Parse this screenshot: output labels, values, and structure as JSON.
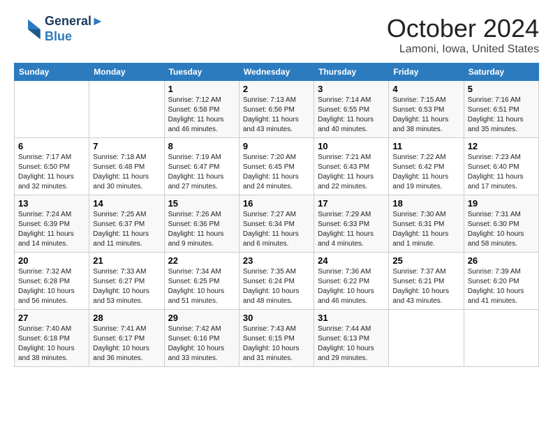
{
  "logo": {
    "line1": "General",
    "line2": "Blue"
  },
  "title": "October 2024",
  "location": "Lamoni, Iowa, United States",
  "days_of_week": [
    "Sunday",
    "Monday",
    "Tuesday",
    "Wednesday",
    "Thursday",
    "Friday",
    "Saturday"
  ],
  "weeks": [
    [
      {
        "day": "",
        "info": ""
      },
      {
        "day": "",
        "info": ""
      },
      {
        "day": "1",
        "info": "Sunrise: 7:12 AM\nSunset: 6:58 PM\nDaylight: 11 hours and 46 minutes."
      },
      {
        "day": "2",
        "info": "Sunrise: 7:13 AM\nSunset: 6:56 PM\nDaylight: 11 hours and 43 minutes."
      },
      {
        "day": "3",
        "info": "Sunrise: 7:14 AM\nSunset: 6:55 PM\nDaylight: 11 hours and 40 minutes."
      },
      {
        "day": "4",
        "info": "Sunrise: 7:15 AM\nSunset: 6:53 PM\nDaylight: 11 hours and 38 minutes."
      },
      {
        "day": "5",
        "info": "Sunrise: 7:16 AM\nSunset: 6:51 PM\nDaylight: 11 hours and 35 minutes."
      }
    ],
    [
      {
        "day": "6",
        "info": "Sunrise: 7:17 AM\nSunset: 6:50 PM\nDaylight: 11 hours and 32 minutes."
      },
      {
        "day": "7",
        "info": "Sunrise: 7:18 AM\nSunset: 6:48 PM\nDaylight: 11 hours and 30 minutes."
      },
      {
        "day": "8",
        "info": "Sunrise: 7:19 AM\nSunset: 6:47 PM\nDaylight: 11 hours and 27 minutes."
      },
      {
        "day": "9",
        "info": "Sunrise: 7:20 AM\nSunset: 6:45 PM\nDaylight: 11 hours and 24 minutes."
      },
      {
        "day": "10",
        "info": "Sunrise: 7:21 AM\nSunset: 6:43 PM\nDaylight: 11 hours and 22 minutes."
      },
      {
        "day": "11",
        "info": "Sunrise: 7:22 AM\nSunset: 6:42 PM\nDaylight: 11 hours and 19 minutes."
      },
      {
        "day": "12",
        "info": "Sunrise: 7:23 AM\nSunset: 6:40 PM\nDaylight: 11 hours and 17 minutes."
      }
    ],
    [
      {
        "day": "13",
        "info": "Sunrise: 7:24 AM\nSunset: 6:39 PM\nDaylight: 11 hours and 14 minutes."
      },
      {
        "day": "14",
        "info": "Sunrise: 7:25 AM\nSunset: 6:37 PM\nDaylight: 11 hours and 11 minutes."
      },
      {
        "day": "15",
        "info": "Sunrise: 7:26 AM\nSunset: 6:36 PM\nDaylight: 11 hours and 9 minutes."
      },
      {
        "day": "16",
        "info": "Sunrise: 7:27 AM\nSunset: 6:34 PM\nDaylight: 11 hours and 6 minutes."
      },
      {
        "day": "17",
        "info": "Sunrise: 7:29 AM\nSunset: 6:33 PM\nDaylight: 11 hours and 4 minutes."
      },
      {
        "day": "18",
        "info": "Sunrise: 7:30 AM\nSunset: 6:31 PM\nDaylight: 11 hours and 1 minute."
      },
      {
        "day": "19",
        "info": "Sunrise: 7:31 AM\nSunset: 6:30 PM\nDaylight: 10 hours and 58 minutes."
      }
    ],
    [
      {
        "day": "20",
        "info": "Sunrise: 7:32 AM\nSunset: 6:28 PM\nDaylight: 10 hours and 56 minutes."
      },
      {
        "day": "21",
        "info": "Sunrise: 7:33 AM\nSunset: 6:27 PM\nDaylight: 10 hours and 53 minutes."
      },
      {
        "day": "22",
        "info": "Sunrise: 7:34 AM\nSunset: 6:25 PM\nDaylight: 10 hours and 51 minutes."
      },
      {
        "day": "23",
        "info": "Sunrise: 7:35 AM\nSunset: 6:24 PM\nDaylight: 10 hours and 48 minutes."
      },
      {
        "day": "24",
        "info": "Sunrise: 7:36 AM\nSunset: 6:22 PM\nDaylight: 10 hours and 46 minutes."
      },
      {
        "day": "25",
        "info": "Sunrise: 7:37 AM\nSunset: 6:21 PM\nDaylight: 10 hours and 43 minutes."
      },
      {
        "day": "26",
        "info": "Sunrise: 7:39 AM\nSunset: 6:20 PM\nDaylight: 10 hours and 41 minutes."
      }
    ],
    [
      {
        "day": "27",
        "info": "Sunrise: 7:40 AM\nSunset: 6:18 PM\nDaylight: 10 hours and 38 minutes."
      },
      {
        "day": "28",
        "info": "Sunrise: 7:41 AM\nSunset: 6:17 PM\nDaylight: 10 hours and 36 minutes."
      },
      {
        "day": "29",
        "info": "Sunrise: 7:42 AM\nSunset: 6:16 PM\nDaylight: 10 hours and 33 minutes."
      },
      {
        "day": "30",
        "info": "Sunrise: 7:43 AM\nSunset: 6:15 PM\nDaylight: 10 hours and 31 minutes."
      },
      {
        "day": "31",
        "info": "Sunrise: 7:44 AM\nSunset: 6:13 PM\nDaylight: 10 hours and 29 minutes."
      },
      {
        "day": "",
        "info": ""
      },
      {
        "day": "",
        "info": ""
      }
    ]
  ]
}
